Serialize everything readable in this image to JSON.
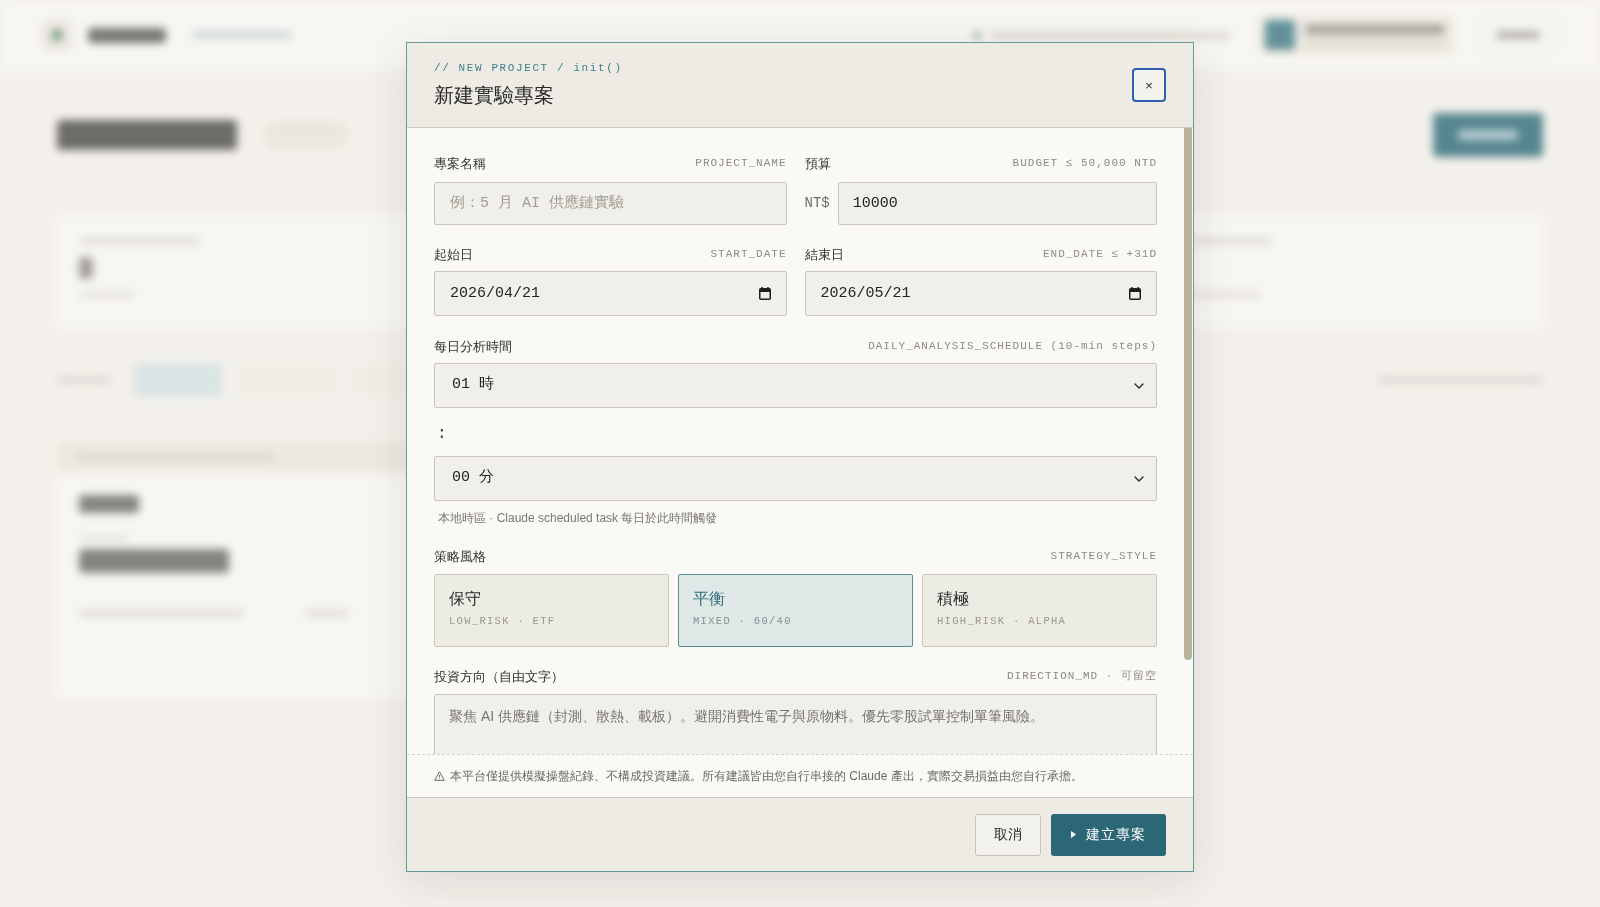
{
  "dialog": {
    "kicker": "// NEW PROJECT / init()",
    "title": "新建實驗專案",
    "close_button": "×",
    "project_name": {
      "label": "專案名稱",
      "key": "PROJECT_NAME",
      "placeholder": "例：5 月 AI 供應鏈實驗"
    },
    "budget": {
      "label": "預算",
      "key": "BUDGET ≤ 50,000 NTD",
      "prefix": "NT$",
      "value": "10000"
    },
    "start_date": {
      "label": "起始日",
      "key": "START_DATE",
      "value": "2026/04/21"
    },
    "end_date": {
      "label": "結束日",
      "key": "END_DATE ≤ +31D",
      "value": "2026/05/21"
    },
    "schedule": {
      "label": "每日分析時間",
      "key": "DAILY_ANALYSIS_SCHEDULE (10-min steps)",
      "hour": "01 時",
      "separator": ":",
      "minute": "00 分",
      "hint": "本地時區 · Claude scheduled task 每日於此時間觸發"
    },
    "strategy": {
      "label": "策略風格",
      "key": "STRATEGY_STYLE",
      "options": [
        {
          "title": "保守",
          "subtitle": "LOW_RISK · ETF",
          "selected": false
        },
        {
          "title": "平衡",
          "subtitle": "MIXED · 60/40",
          "selected": true
        },
        {
          "title": "積極",
          "subtitle": "HIGH_RISK · ALPHA",
          "selected": false
        }
      ]
    },
    "direction": {
      "label": "投資方向（自由文字）",
      "key": "DIRECTION_MD · 可留空",
      "placeholder": "聚焦 AI 供應鏈（封測、散熱、載板）。避開消費性電子與原物料。優先零股試單控制單筆風險。"
    },
    "disclaimer": "本平台僅提供模擬操盤紀錄、不構成投資建議。所有建議皆由您自行串接的 Claude 產出，實際交易損益由您自行承擔。",
    "buttons": [
      {
        "label": "取消",
        "kind": "secondary"
      },
      {
        "label": "建立專案",
        "kind": "primary"
      }
    ]
  }
}
